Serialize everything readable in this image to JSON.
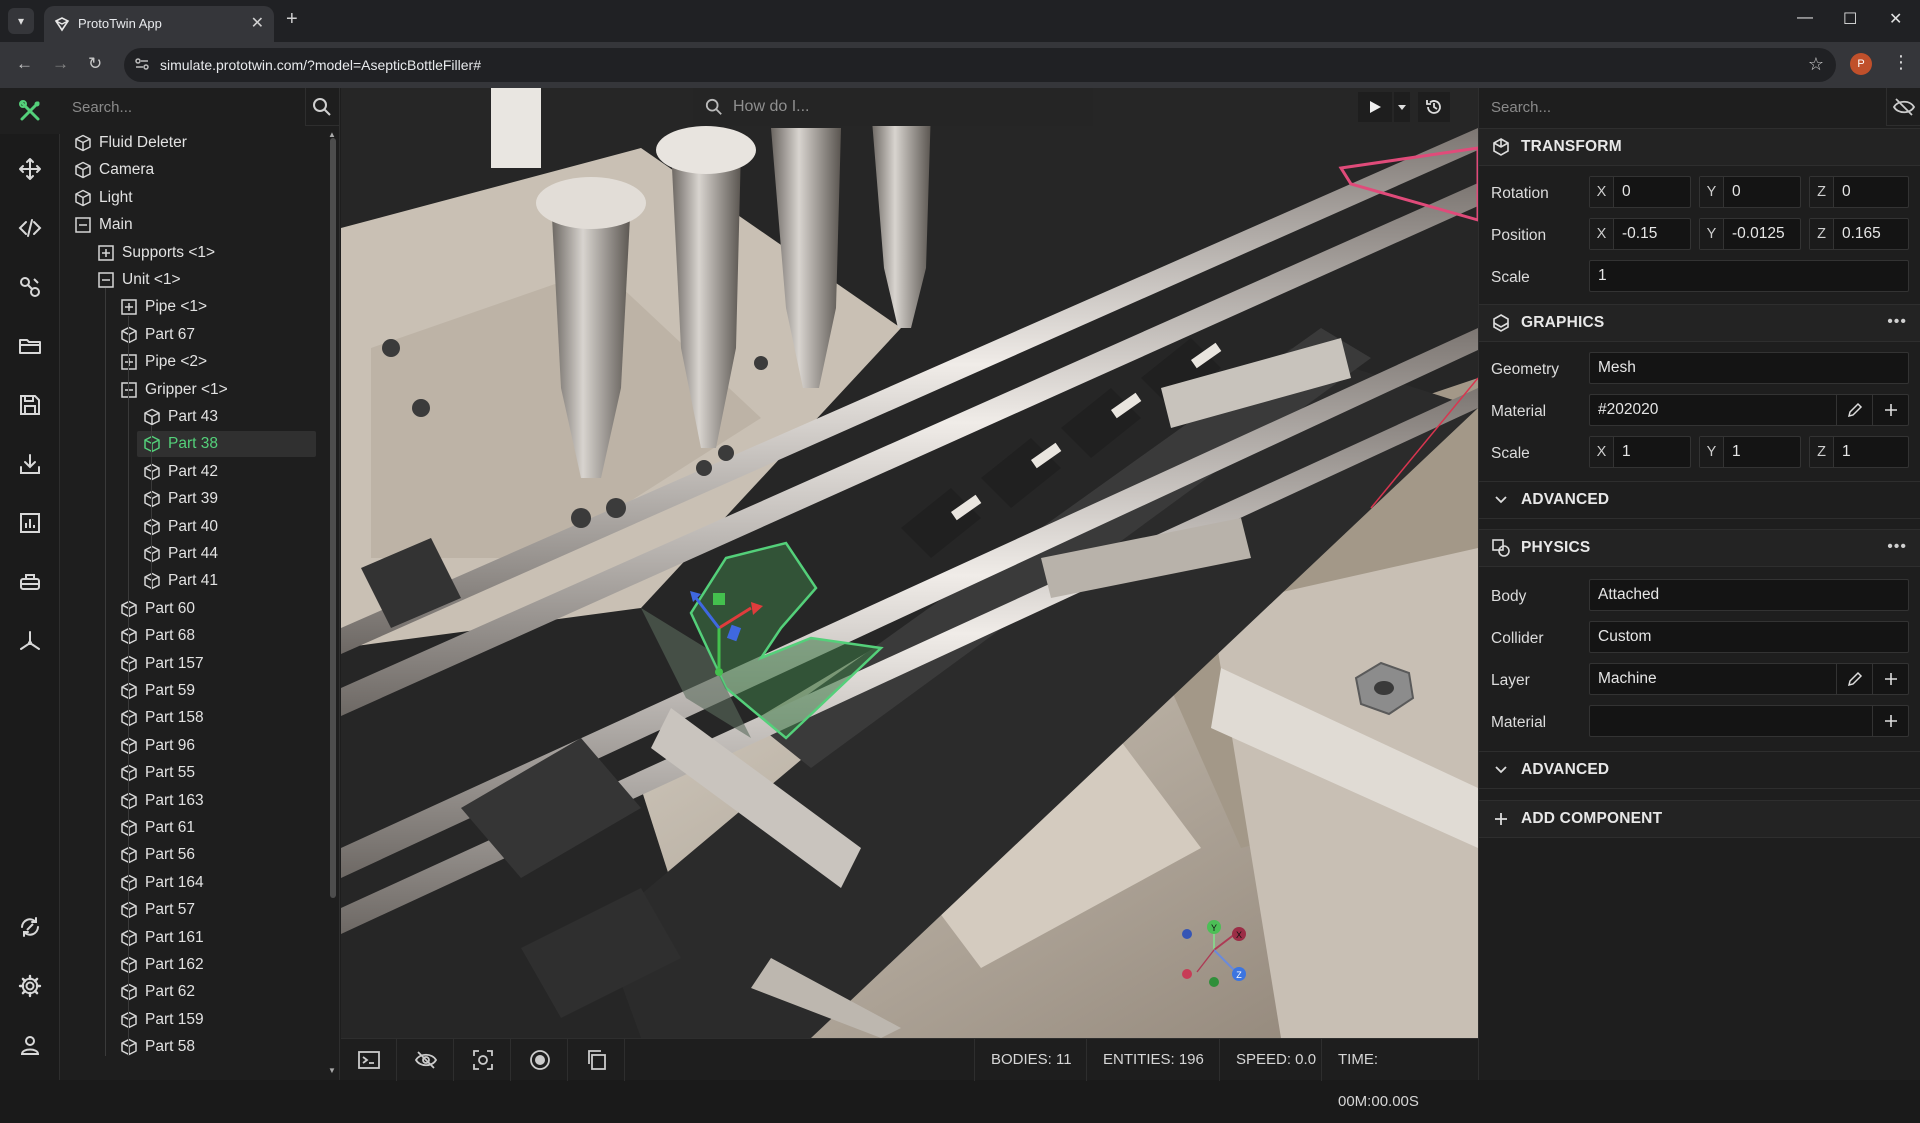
{
  "browser": {
    "tab_title": "ProtoTwin App",
    "url": "simulate.prototwin.com/?model=AsepticBottleFiller#",
    "profile_initial": "P"
  },
  "hierarchy": {
    "search_placeholder": "Search...",
    "items": [
      {
        "label": "Fluid Deleter",
        "icon": "cube-icon"
      },
      {
        "label": "Camera",
        "icon": "cube-icon"
      },
      {
        "label": "Light",
        "icon": "cube-icon"
      },
      {
        "label": "Main",
        "icon": "collapse-box-icon"
      },
      {
        "label": "Supports <1>",
        "icon": "expand-box-icon"
      },
      {
        "label": "Unit <1>",
        "icon": "collapse-box-icon"
      },
      {
        "label": "Pipe <1>",
        "icon": "expand-box-icon"
      },
      {
        "label": "Part 67",
        "icon": "cube-icon"
      },
      {
        "label": "Pipe <2>",
        "icon": "expand-box-icon"
      },
      {
        "label": "Gripper <1>",
        "icon": "collapse-box-icon"
      },
      {
        "label": "Part 43",
        "icon": "cube-icon"
      },
      {
        "label": "Part 38",
        "icon": "cube-icon"
      },
      {
        "label": "Part 42",
        "icon": "cube-icon"
      },
      {
        "label": "Part 39",
        "icon": "cube-icon"
      },
      {
        "label": "Part 40",
        "icon": "cube-icon"
      },
      {
        "label": "Part 44",
        "icon": "cube-icon"
      },
      {
        "label": "Part 41",
        "icon": "cube-icon"
      },
      {
        "label": "Part 60",
        "icon": "cube-icon"
      },
      {
        "label": "Part 68",
        "icon": "cube-icon"
      },
      {
        "label": "Part 157",
        "icon": "cube-icon"
      },
      {
        "label": "Part 59",
        "icon": "cube-icon"
      },
      {
        "label": "Part 158",
        "icon": "cube-icon"
      },
      {
        "label": "Part 96",
        "icon": "cube-icon"
      },
      {
        "label": "Part 55",
        "icon": "cube-icon"
      },
      {
        "label": "Part 163",
        "icon": "cube-icon"
      },
      {
        "label": "Part 61",
        "icon": "cube-icon"
      },
      {
        "label": "Part 56",
        "icon": "cube-icon"
      },
      {
        "label": "Part 164",
        "icon": "cube-icon"
      },
      {
        "label": "Part 57",
        "icon": "cube-icon"
      },
      {
        "label": "Part 161",
        "icon": "cube-icon"
      },
      {
        "label": "Part 162",
        "icon": "cube-icon"
      },
      {
        "label": "Part 62",
        "icon": "cube-icon"
      },
      {
        "label": "Part 159",
        "icon": "cube-icon"
      },
      {
        "label": "Part 58",
        "icon": "cube-icon"
      }
    ],
    "selected": "Part 38"
  },
  "viewport": {
    "search_placeholder": "How do I...",
    "gizmo_axes": [
      "Y",
      "X",
      "Z"
    ]
  },
  "statusbar": {
    "bodies": "BODIES: 11",
    "entities": "ENTITIES: 196",
    "speed": "SPEED: 0.0",
    "time": "TIME: 00M:00.00S"
  },
  "inspector": {
    "search_placeholder": "Search...",
    "transform": {
      "title": "TRANSFORM",
      "rotation_label": "Rotation",
      "position_label": "Position",
      "scale_label": "Scale",
      "axis_x": "X",
      "axis_y": "Y",
      "axis_z": "Z",
      "rotation": {
        "x": "0",
        "y": "0",
        "z": "0"
      },
      "position": {
        "x": "-0.15",
        "y": "-0.0125",
        "z": "0.165"
      },
      "scale": "1"
    },
    "graphics": {
      "title": "GRAPHICS",
      "geometry_label": "Geometry",
      "geometry": "Mesh",
      "material_label": "Material",
      "material": "#202020",
      "scale_label": "Scale",
      "scale": {
        "x": "1",
        "y": "1",
        "z": "1"
      },
      "advanced": "ADVANCED"
    },
    "physics": {
      "title": "PHYSICS",
      "body_label": "Body",
      "body": "Attached",
      "collider_label": "Collider",
      "collider": "Custom",
      "layer_label": "Layer",
      "layer": "Machine",
      "material_label": "Material",
      "material": "",
      "advanced": "ADVANCED"
    },
    "add_component": "ADD COMPONENT"
  },
  "colors": {
    "accent": "#54d07a",
    "background": "#1e1e1e",
    "panel_header": "#232323"
  }
}
